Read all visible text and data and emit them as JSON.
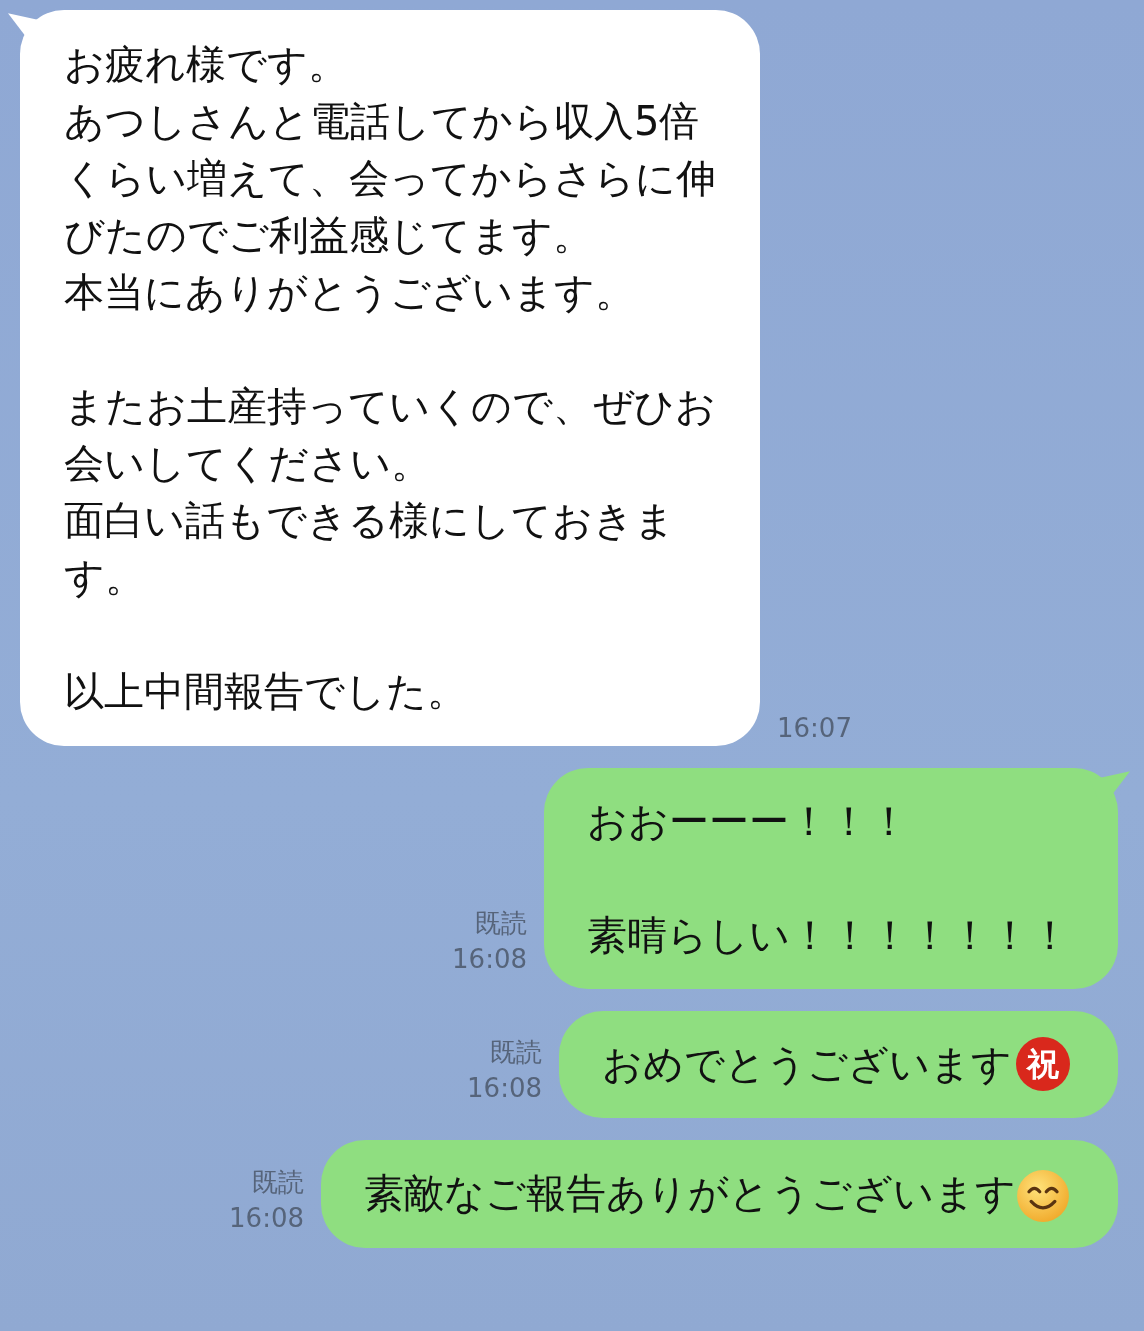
{
  "messages": [
    {
      "kind": "incoming",
      "tail": true,
      "paragraphs": [
        [
          "お疲れ様です。",
          "あつしさんと電話してから収入5倍",
          "くらい増えて、会ってからさらに伸",
          "びたのでご利益感じてます。",
          "本当にありがとうございます。"
        ],
        [
          "またお土産持っていくので、ぜひお",
          "会いしてください。",
          "面白い話もできる様にしておきま",
          "す。"
        ],
        [
          "以上中間報告でした。"
        ]
      ],
      "time": "16:07"
    },
    {
      "kind": "outgoing",
      "tail": true,
      "paragraphs": [
        [
          "おおーーー！！！"
        ],
        [
          "素晴らしい！！！！！！！"
        ]
      ],
      "read": "既読",
      "time": "16:08"
    },
    {
      "kind": "outgoing",
      "tail": false,
      "paragraphs": [
        [
          "おめでとうございます"
        ]
      ],
      "emoji": {
        "kind": "badge",
        "text": "祝"
      },
      "read": "既読",
      "time": "16:08"
    },
    {
      "kind": "outgoing",
      "tail": false,
      "paragraphs": [
        [
          "素敵なご報告ありがとうございます"
        ]
      ],
      "emoji": {
        "kind": "smile"
      },
      "read": "既読",
      "time": "16:08"
    }
  ]
}
